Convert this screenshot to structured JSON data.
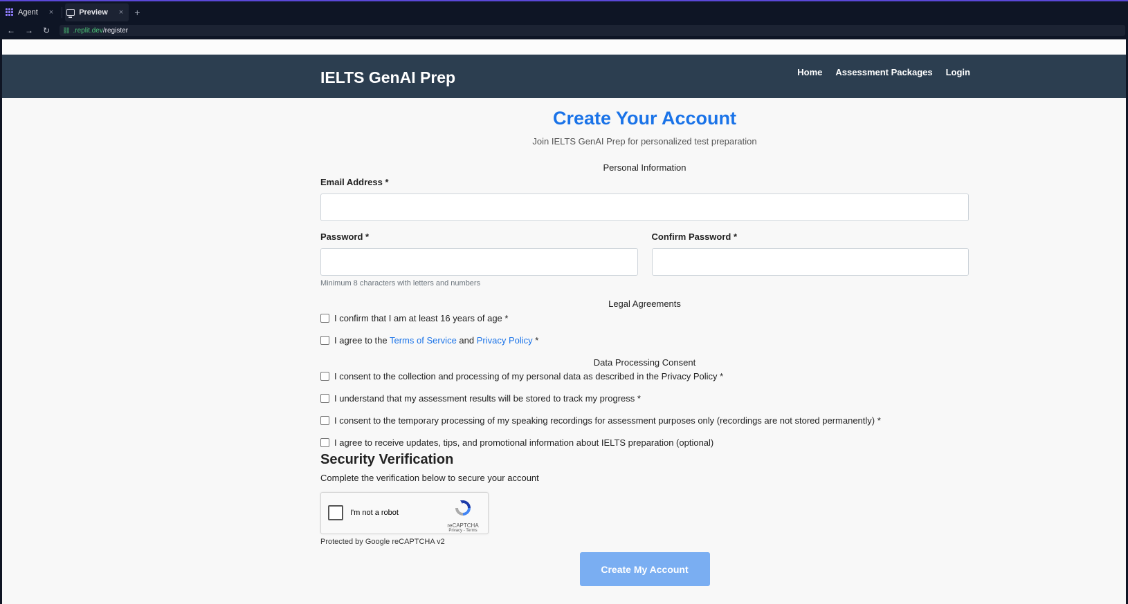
{
  "tabs": [
    {
      "label": "Agent",
      "icon": "agent-icon"
    },
    {
      "label": "Preview",
      "icon": "monitor-icon",
      "active": true
    }
  ],
  "tab_close": "×",
  "tab_add": "+",
  "urlbar": {
    "back": "←",
    "forward": "→",
    "reload": "↻",
    "lock": "🔗",
    "host": ".replit.dev",
    "path": "/register"
  },
  "site": {
    "brand": "IELTS GenAI Prep",
    "nav": [
      "Home",
      "Assessment Packages",
      "Login"
    ]
  },
  "form": {
    "title": "Create Your Account",
    "subtitle": "Join IELTS GenAI Prep for personalized test preparation",
    "personal_section": "Personal Information",
    "email_label": "Email Address *",
    "password_label": "Password *",
    "confirm_label": "Confirm Password *",
    "password_hint": "Minimum 8 characters with letters and numbers",
    "legal_section": "Legal Agreements",
    "age_confirm": "I confirm that I am at least 16 years of age *",
    "terms_prefix": "I agree to the ",
    "terms_link": "Terms of Service",
    "terms_mid": " and ",
    "privacy_link": "Privacy Policy",
    "terms_suffix": " *",
    "data_section": "Data Processing Consent",
    "consent_personal": "I consent to the collection and processing of my personal data as described in the Privacy Policy *",
    "consent_results": "I understand that my assessment results will be stored to track my progress *",
    "consent_speaking": "I consent to the temporary processing of my speaking recordings for assessment purposes only (recordings are not stored permanently) *",
    "consent_marketing": "I agree to receive updates, tips, and promotional information about IELTS preparation (optional)",
    "security_heading": "Security Verification",
    "security_text": "Complete the verification below to secure your account",
    "recaptcha_label": "I'm not a robot",
    "recaptcha_name": "reCAPTCHA",
    "recaptcha_links": "Privacy - Terms",
    "recaptcha_note": "Protected by Google reCAPTCHA v2",
    "submit": "Create My Account"
  },
  "colors": {
    "header_bg": "#2c3e50",
    "title_blue": "#1a73e8",
    "button_bg": "#7aaef2"
  }
}
